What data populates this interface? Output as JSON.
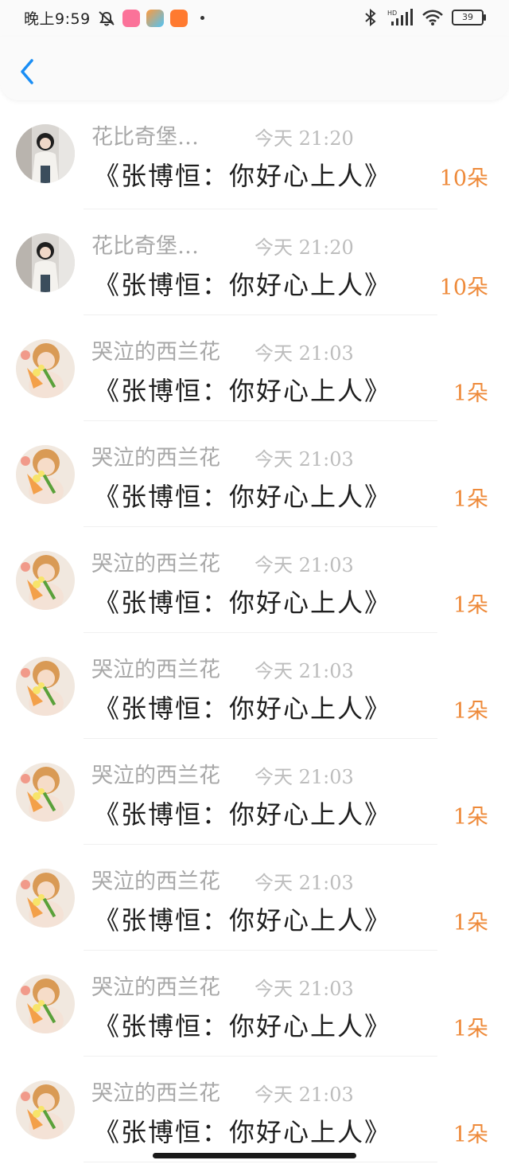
{
  "status": {
    "time": "晚上9:59",
    "battery": "39"
  },
  "rows": [
    {
      "username": "花比奇堡…",
      "time": "今天 21:20",
      "title": "《张博恒：你好心上人》",
      "count": "10朵",
      "avatar": "girl"
    },
    {
      "username": "花比奇堡…",
      "time": "今天 21:20",
      "title": "《张博恒：你好心上人》",
      "count": "10朵",
      "avatar": "girl"
    },
    {
      "username": "哭泣的西兰花",
      "time": "今天 21:03",
      "title": "《张博恒：你好心上人》",
      "count": "1朵",
      "avatar": "doll"
    },
    {
      "username": "哭泣的西兰花",
      "time": "今天 21:03",
      "title": "《张博恒：你好心上人》",
      "count": "1朵",
      "avatar": "doll"
    },
    {
      "username": "哭泣的西兰花",
      "time": "今天 21:03",
      "title": "《张博恒：你好心上人》",
      "count": "1朵",
      "avatar": "doll"
    },
    {
      "username": "哭泣的西兰花",
      "time": "今天 21:03",
      "title": "《张博恒：你好心上人》",
      "count": "1朵",
      "avatar": "doll"
    },
    {
      "username": "哭泣的西兰花",
      "time": "今天 21:03",
      "title": "《张博恒：你好心上人》",
      "count": "1朵",
      "avatar": "doll"
    },
    {
      "username": "哭泣的西兰花",
      "time": "今天 21:03",
      "title": "《张博恒：你好心上人》",
      "count": "1朵",
      "avatar": "doll"
    },
    {
      "username": "哭泣的西兰花",
      "time": "今天 21:03",
      "title": "《张博恒：你好心上人》",
      "count": "1朵",
      "avatar": "doll"
    },
    {
      "username": "哭泣的西兰花",
      "time": "今天 21:03",
      "title": "《张博恒：你好心上人》",
      "count": "1朵",
      "avatar": "doll"
    }
  ],
  "colors": {
    "accent": "#1a8ef5",
    "count": "#ee8a3a"
  },
  "icons": {
    "back": "chevron-left-icon",
    "bluetooth": "bluetooth-icon",
    "wifi": "wifi-icon",
    "signal": "signal-icon"
  }
}
